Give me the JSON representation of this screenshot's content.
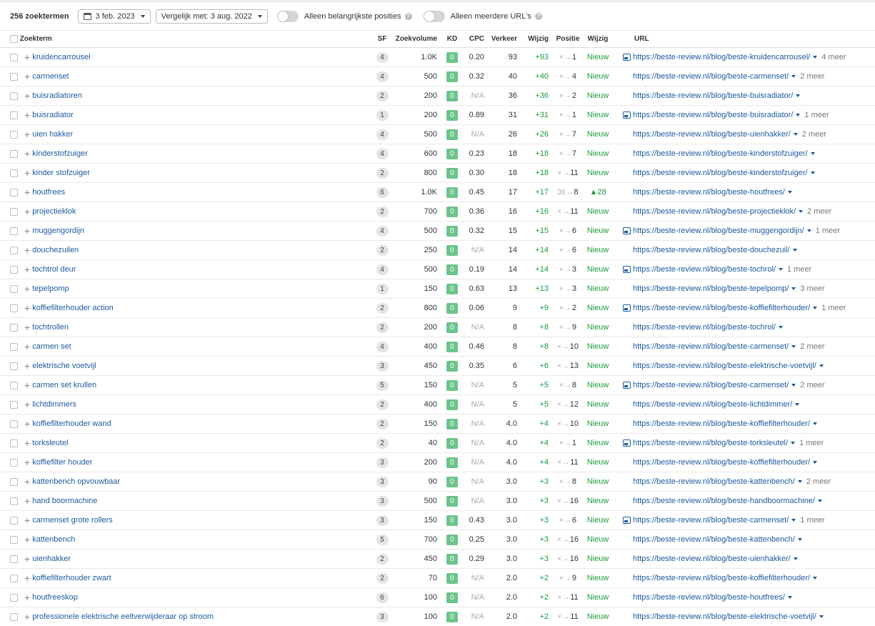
{
  "toolbar": {
    "count": "256 zoektermen",
    "date": "3 feb. 2023",
    "compare": "Vergelijk met: 3 aug. 2022",
    "toggle1": "Alleen belangrijkste posities",
    "toggle2": "Alleen meerdere URL's"
  },
  "columns": [
    "Zoekterm",
    "SF",
    "Zoekvolume",
    "KD",
    "CPC",
    "Verkeer",
    "Wijzig",
    "Positie",
    "Wijzig",
    "URL"
  ],
  "rows": [
    {
      "kw": "kruidencarrousel",
      "sf": "4",
      "vol": "1.0K",
      "kd": "0",
      "cpc": "0.20",
      "traffic": "93",
      "tchange": "+93",
      "from": "×",
      "to": "1",
      "pchange": "Nieuw",
      "img": true,
      "url": "https://beste-review.nl/blog/beste-kruidencarrousel/",
      "meer": "4 meer"
    },
    {
      "kw": "carmenset",
      "sf": "4",
      "vol": "500",
      "kd": "0",
      "cpc": "0.32",
      "traffic": "40",
      "tchange": "+40",
      "from": "×",
      "to": "4",
      "pchange": "Nieuw",
      "img": false,
      "url": "https://beste-review.nl/blog/beste-carmenset/",
      "meer": "2 meer"
    },
    {
      "kw": "buisradiatoren",
      "sf": "2",
      "vol": "200",
      "kd": "0",
      "cpc": "N/A",
      "traffic": "36",
      "tchange": "+36",
      "from": "×",
      "to": "2",
      "pchange": "Nieuw",
      "img": false,
      "url": "https://beste-review.nl/blog/beste-buisradiator/",
      "meer": ""
    },
    {
      "kw": "buisradiator",
      "sf": "1",
      "vol": "200",
      "kd": "0",
      "cpc": "0.89",
      "traffic": "31",
      "tchange": "+31",
      "from": "×",
      "to": "1",
      "pchange": "Nieuw",
      "img": true,
      "url": "https://beste-review.nl/blog/beste-buisradiator/",
      "meer": "1 meer"
    },
    {
      "kw": "uien hakker",
      "sf": "4",
      "vol": "500",
      "kd": "0",
      "cpc": "N/A",
      "traffic": "26",
      "tchange": "+26",
      "from": "×",
      "to": "7",
      "pchange": "Nieuw",
      "img": false,
      "url": "https://beste-review.nl/blog/beste-uienhakker/",
      "meer": "2 meer"
    },
    {
      "kw": "kinderstofzuiger",
      "sf": "4",
      "vol": "600",
      "kd": "0",
      "cpc": "0.23",
      "traffic": "18",
      "tchange": "+18",
      "from": "×",
      "to": "7",
      "pchange": "Nieuw",
      "img": false,
      "url": "https://beste-review.nl/blog/beste-kinderstofzuiger/",
      "meer": ""
    },
    {
      "kw": "kinder stofzuiger",
      "sf": "2",
      "vol": "800",
      "kd": "0",
      "cpc": "0.30",
      "traffic": "18",
      "tchange": "+18",
      "from": "×",
      "to": "11",
      "pchange": "Nieuw",
      "img": false,
      "url": "https://beste-review.nl/blog/beste-kinderstofzuiger/",
      "meer": ""
    },
    {
      "kw": "houtfrees",
      "sf": "6",
      "vol": "1.0K",
      "kd": "0",
      "cpc": "0.45",
      "traffic": "17",
      "tchange": "+17",
      "from": "36",
      "to": "8",
      "pchange": "▲28",
      "img": false,
      "url": "https://beste-review.nl/blog/beste-houtfrees/",
      "meer": ""
    },
    {
      "kw": "projectieklok",
      "sf": "2",
      "vol": "700",
      "kd": "0",
      "cpc": "0.36",
      "traffic": "16",
      "tchange": "+16",
      "from": "×",
      "to": "11",
      "pchange": "Nieuw",
      "img": false,
      "url": "https://beste-review.nl/blog/beste-projectieklok/",
      "meer": "2 meer"
    },
    {
      "kw": "muggengordijn",
      "sf": "4",
      "vol": "500",
      "kd": "0",
      "cpc": "0.32",
      "traffic": "15",
      "tchange": "+15",
      "from": "×",
      "to": "6",
      "pchange": "Nieuw",
      "img": true,
      "url": "https://beste-review.nl/blog/beste-muggengordijn/",
      "meer": "1 meer"
    },
    {
      "kw": "douchezuilen",
      "sf": "2",
      "vol": "250",
      "kd": "0",
      "cpc": "N/A",
      "traffic": "14",
      "tchange": "+14",
      "from": "×",
      "to": "6",
      "pchange": "Nieuw",
      "img": false,
      "url": "https://beste-review.nl/blog/beste-douchezuil/",
      "meer": ""
    },
    {
      "kw": "tochtrol deur",
      "sf": "4",
      "vol": "500",
      "kd": "0",
      "cpc": "0.19",
      "traffic": "14",
      "tchange": "+14",
      "from": "×",
      "to": "3",
      "pchange": "Nieuw",
      "img": true,
      "url": "https://beste-review.nl/blog/beste-tochrol/",
      "meer": "1 meer"
    },
    {
      "kw": "tepelpomp",
      "sf": "1",
      "vol": "150",
      "kd": "0",
      "cpc": "0.63",
      "traffic": "13",
      "tchange": "+13",
      "from": "×",
      "to": "3",
      "pchange": "Nieuw",
      "img": false,
      "url": "https://beste-review.nl/blog/beste-tepelpomp/",
      "meer": "3 meer"
    },
    {
      "kw": "koffiefilterhouder action",
      "sf": "2",
      "vol": "800",
      "kd": "0",
      "cpc": "0.06",
      "traffic": "9",
      "tchange": "+9",
      "from": "×",
      "to": "2",
      "pchange": "Nieuw",
      "img": true,
      "url": "https://beste-review.nl/blog/beste-koffiefilterhouder/",
      "meer": "1 meer"
    },
    {
      "kw": "tochtrollen",
      "sf": "2",
      "vol": "200",
      "kd": "0",
      "cpc": "N/A",
      "traffic": "8",
      "tchange": "+8",
      "from": "×",
      "to": "9",
      "pchange": "Nieuw",
      "img": false,
      "url": "https://beste-review.nl/blog/beste-tochrol/",
      "meer": ""
    },
    {
      "kw": "carmen set",
      "sf": "4",
      "vol": "400",
      "kd": "0",
      "cpc": "0.46",
      "traffic": "8",
      "tchange": "+8",
      "from": "×",
      "to": "10",
      "pchange": "Nieuw",
      "img": false,
      "url": "https://beste-review.nl/blog/beste-carmenset/",
      "meer": "2 meer"
    },
    {
      "kw": "elektrische voetvijl",
      "sf": "3",
      "vol": "450",
      "kd": "0",
      "cpc": "0.35",
      "traffic": "6",
      "tchange": "+6",
      "from": "×",
      "to": "13",
      "pchange": "Nieuw",
      "img": false,
      "url": "https://beste-review.nl/blog/beste-elektrische-voetvijl/",
      "meer": ""
    },
    {
      "kw": "carmen set krullen",
      "sf": "5",
      "vol": "150",
      "kd": "0",
      "cpc": "N/A",
      "traffic": "5",
      "tchange": "+5",
      "from": "×",
      "to": "8",
      "pchange": "Nieuw",
      "img": true,
      "url": "https://beste-review.nl/blog/beste-carmenset/",
      "meer": "2 meer"
    },
    {
      "kw": "lichtdimmers",
      "sf": "2",
      "vol": "400",
      "kd": "0",
      "cpc": "N/A",
      "traffic": "5",
      "tchange": "+5",
      "from": "×",
      "to": "12",
      "pchange": "Nieuw",
      "img": false,
      "url": "https://beste-review.nl/blog/beste-lichtdimmer/",
      "meer": ""
    },
    {
      "kw": "koffiefilterhouder wand",
      "sf": "2",
      "vol": "150",
      "kd": "0",
      "cpc": "N/A",
      "traffic": "4.0",
      "tchange": "+4",
      "from": "×",
      "to": "10",
      "pchange": "Nieuw",
      "img": false,
      "url": "https://beste-review.nl/blog/beste-koffiefilterhouder/",
      "meer": ""
    },
    {
      "kw": "torksleutel",
      "sf": "2",
      "vol": "40",
      "kd": "0",
      "cpc": "N/A",
      "traffic": "4.0",
      "tchange": "+4",
      "from": "×",
      "to": "1",
      "pchange": "Nieuw",
      "img": true,
      "url": "https://beste-review.nl/blog/beste-torksleutel/",
      "meer": "1 meer"
    },
    {
      "kw": "koffiefilter houder",
      "sf": "3",
      "vol": "200",
      "kd": "0",
      "cpc": "N/A",
      "traffic": "4.0",
      "tchange": "+4",
      "from": "×",
      "to": "11",
      "pchange": "Nieuw",
      "img": false,
      "url": "https://beste-review.nl/blog/beste-koffiefilterhouder/",
      "meer": ""
    },
    {
      "kw": "kattenbench opvouwbaar",
      "sf": "3",
      "vol": "90",
      "kd": "0",
      "cpc": "N/A",
      "traffic": "3.0",
      "tchange": "+3",
      "from": "×",
      "to": "8",
      "pchange": "Nieuw",
      "img": false,
      "url": "https://beste-review.nl/blog/beste-kattenbench/",
      "meer": "2 meer"
    },
    {
      "kw": "hand boormachine",
      "sf": "3",
      "vol": "500",
      "kd": "0",
      "cpc": "N/A",
      "traffic": "3.0",
      "tchange": "+3",
      "from": "×",
      "to": "16",
      "pchange": "Nieuw",
      "img": false,
      "url": "https://beste-review.nl/blog/beste-handboormachine/",
      "meer": ""
    },
    {
      "kw": "carmenset grote rollers",
      "sf": "3",
      "vol": "150",
      "kd": "0",
      "cpc": "0.43",
      "traffic": "3.0",
      "tchange": "+3",
      "from": "×",
      "to": "6",
      "pchange": "Nieuw",
      "img": true,
      "url": "https://beste-review.nl/blog/beste-carmenset/",
      "meer": "1 meer"
    },
    {
      "kw": "kattenbench",
      "sf": "5",
      "vol": "700",
      "kd": "0",
      "cpc": "0.25",
      "traffic": "3.0",
      "tchange": "+3",
      "from": "×",
      "to": "16",
      "pchange": "Nieuw",
      "img": false,
      "url": "https://beste-review.nl/blog/beste-kattenbench/",
      "meer": ""
    },
    {
      "kw": "uienhakker",
      "sf": "2",
      "vol": "450",
      "kd": "0",
      "cpc": "0.29",
      "traffic": "3.0",
      "tchange": "+3",
      "from": "×",
      "to": "16",
      "pchange": "Nieuw",
      "img": false,
      "url": "https://beste-review.nl/blog/beste-uienhakker/",
      "meer": ""
    },
    {
      "kw": "koffiefilterhouder zwart",
      "sf": "2",
      "vol": "70",
      "kd": "0",
      "cpc": "N/A",
      "traffic": "2.0",
      "tchange": "+2",
      "from": "×",
      "to": "9",
      "pchange": "Nieuw",
      "img": false,
      "url": "https://beste-review.nl/blog/beste-koffiefilterhouder/",
      "meer": ""
    },
    {
      "kw": "houtfreeskop",
      "sf": "6",
      "vol": "100",
      "kd": "0",
      "cpc": "N/A",
      "traffic": "2.0",
      "tchange": "+2",
      "from": "×",
      "to": "11",
      "pchange": "Nieuw",
      "img": false,
      "url": "https://beste-review.nl/blog/beste-houtfrees/",
      "meer": ""
    },
    {
      "kw": "professionele elektrische eeltverwijderaar op stroom",
      "sf": "3",
      "vol": "100",
      "kd": "0",
      "cpc": "N/A",
      "traffic": "2.0",
      "tchange": "+2",
      "from": "×",
      "to": "11",
      "pchange": "Nieuw",
      "img": false,
      "url": "https://beste-review.nl/blog/beste-elektrische-voetvijl/",
      "meer": ""
    }
  ]
}
